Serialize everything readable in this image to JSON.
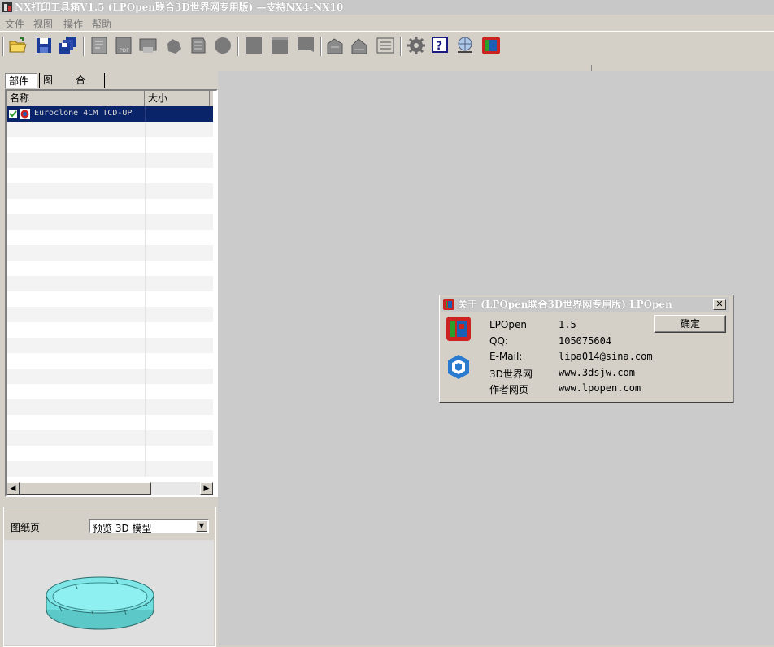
{
  "window": {
    "title": "NX打印工具箱V1.5 (LPOpen联合3D世界网专用版) —支持NX4-NX10"
  },
  "menu": {
    "items": [
      "文件",
      "视图",
      "操作",
      "帮助"
    ]
  },
  "toolbar": {
    "icons": [
      "open-folder-icon",
      "save-icon",
      "save-all-icon",
      "print-icon",
      "pdf-icon",
      "print-batch-icon",
      "shape-icon",
      "document-icon",
      "circle-icon",
      "square-icon",
      "square-2-icon",
      "square-3-icon",
      "sheet-icon",
      "sheet-2-icon",
      "list-icon",
      "settings-icon",
      "help-icon",
      "web-icon",
      "lpopen-logo-icon"
    ]
  },
  "left_panel": {
    "tabs": [
      "部件",
      "图纸",
      "合并"
    ],
    "active_tab": "部件",
    "columns": [
      "名称",
      "大小"
    ],
    "rows": [
      {
        "name": "Euroclone 4CM TCD-UP",
        "size": "",
        "selected": true
      }
    ]
  },
  "preview": {
    "label": "图纸页",
    "combo_value": "预览 3D 模型"
  },
  "about_dialog": {
    "title": "关于 (LPOpen联合3D世界网专用版) LPOpen",
    "ok_label": "确定",
    "fields": [
      {
        "key": "LPOpen",
        "value": "1.5"
      },
      {
        "key": "QQ:",
        "value": "105075604"
      },
      {
        "key": "E-Mail:",
        "value": "lipa014@sina.com"
      },
      {
        "key": "3D世界网",
        "value": "www.3dsjw.com"
      },
      {
        "key": "作者网页",
        "value": "www.lpopen.com"
      }
    ]
  },
  "colors": {
    "selection": "#0a246a",
    "model_cyan": "#6fdede",
    "logo_red": "#cc2222",
    "logo_blue": "#1a5fb4",
    "logo_green": "#2aa02a"
  }
}
